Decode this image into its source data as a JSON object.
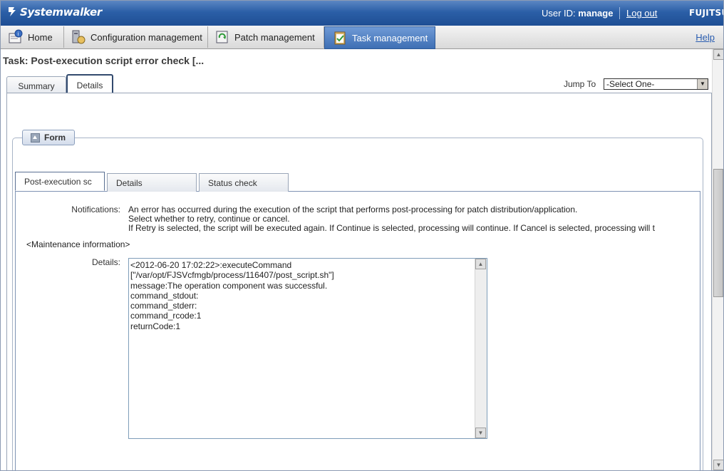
{
  "header": {
    "brand": "Systemwalker",
    "user_id_label": "User ID:",
    "user_id_value": "manage",
    "logout": "Log out",
    "vendor": "FUJITSU"
  },
  "nav": {
    "tabs": [
      {
        "label": "Home",
        "icon": "home-info-icon"
      },
      {
        "label": "Configuration management",
        "icon": "configuration-icon"
      },
      {
        "label": "Patch management",
        "icon": "patch-icon"
      },
      {
        "label": "Task management",
        "icon": "task-clipboard-icon",
        "active": true
      }
    ],
    "help": "Help"
  },
  "page": {
    "title": "Task: Post-execution script error check [...",
    "tabs": [
      {
        "label": "Summary"
      },
      {
        "label": "Details",
        "active": true
      }
    ],
    "jump_to_label": "Jump To",
    "jump_to_value": "-Select One-"
  },
  "form": {
    "header": "Form",
    "tabs": [
      {
        "label": "Post-execution sc",
        "active": true
      },
      {
        "label": "Details"
      },
      {
        "label": "Status check"
      }
    ],
    "notifications_label": "Notifications:",
    "notifications_lines": [
      "An error has occurred during the execution of the script that performs post-processing for patch distribution/application.",
      "Select whether to retry, continue or cancel.",
      "If Retry is selected, the script will be executed again. If Continue is selected, processing will continue. If Cancel is selected, processing will t"
    ],
    "maintenance_label": "<Maintenance information>",
    "details_label": "Details:",
    "details_text": "<2012-06-20 17:02:22>:executeCommand\n[\"/var/opt/FJSVcfmgb/process/116407/post_script.sh\"]\nmessage:The operation component was successful.\ncommand_stdout:\ncommand_stderr:\ncommand_rcode:1\nreturnCode:1"
  },
  "colors": {
    "header_blue": "#2b5fa7",
    "active_tab": "#4a7bc0",
    "link_blue": "#2a5db0"
  }
}
